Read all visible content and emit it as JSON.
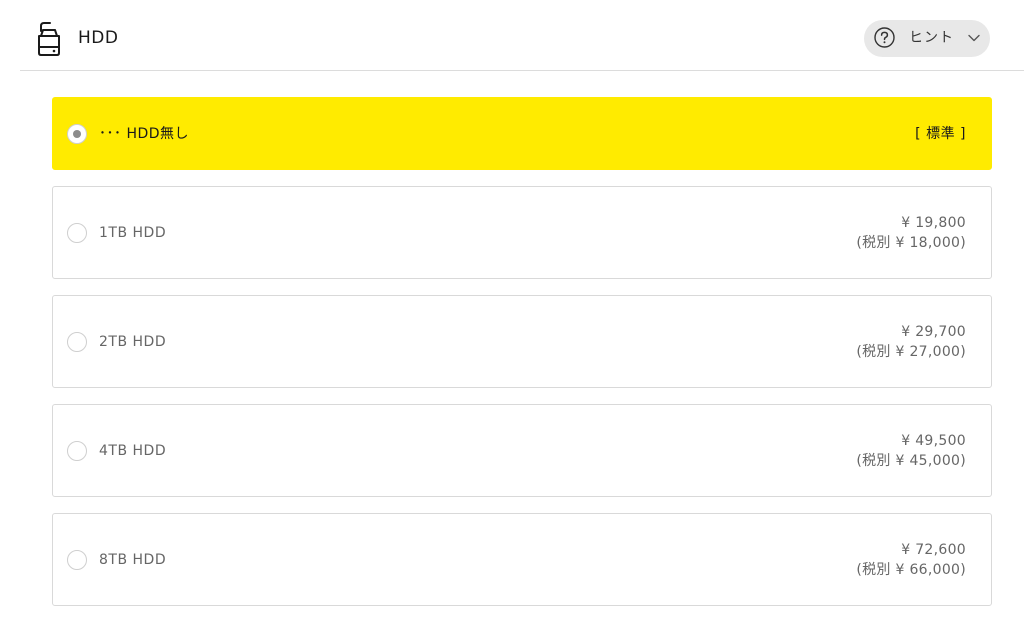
{
  "header": {
    "icon": "hdd-icon",
    "title": "HDD",
    "hint_button": {
      "icon": "question-circle-icon",
      "label": "ヒント",
      "chevron": "chevron-down-icon"
    }
  },
  "colors": {
    "selected_bg": "#ffeb00",
    "border": "#d9d9d9",
    "hint_bg": "#e8e8e8"
  },
  "options": [
    {
      "label": "･･･ HDD無し",
      "standard": "[ 標準 ]",
      "selected": true
    },
    {
      "label": "1TB HDD",
      "price": "¥ 19,800",
      "price_ex_tax": "(税別 ¥ 18,000)",
      "selected": false
    },
    {
      "label": "2TB HDD",
      "price": "¥ 29,700",
      "price_ex_tax": "(税別 ¥ 27,000)",
      "selected": false
    },
    {
      "label": "4TB HDD",
      "price": "¥ 49,500",
      "price_ex_tax": "(税別 ¥ 45,000)",
      "selected": false
    },
    {
      "label": "8TB HDD",
      "price": "¥ 72,600",
      "price_ex_tax": "(税別 ¥ 66,000)",
      "selected": false
    }
  ]
}
